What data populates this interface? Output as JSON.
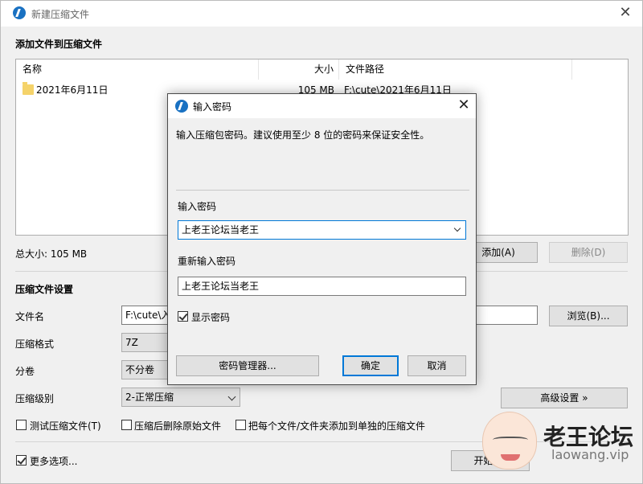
{
  "window": {
    "title": "新建压缩文件",
    "close_glyph": "✕"
  },
  "add_section": {
    "title": "添加文件到压缩文件"
  },
  "file_list": {
    "columns": [
      "名称",
      "大小",
      "文件路径"
    ],
    "rows": [
      {
        "name": "2021年6月11日",
        "size": "105 MB",
        "path": "F:\\cute\\2021年6月11日"
      }
    ]
  },
  "total_size": "总大小: 105 MB",
  "buttons": {
    "add": "添加(A)",
    "delete": "删除(D)",
    "browse": "浏览(B)...",
    "advanced": "高级设置 »",
    "start": "开始(S)"
  },
  "settings": {
    "title": "压缩文件设置",
    "filename_label": "文件名",
    "filename_value": "F:\\cute\\入",
    "format_label": "压缩格式",
    "format_value": "7Z",
    "split_label": "分卷",
    "split_value": "不分卷",
    "level_label": "压缩级别",
    "level_value": "2-正常压缩"
  },
  "options": {
    "test": "测试压缩文件(T)",
    "delete_after": "压缩后删除原始文件",
    "each_separate": "把每个文件/文件夹添加到单独的压缩文件",
    "more": "更多选项..."
  },
  "dialog": {
    "title": "输入密码",
    "close_glyph": "✕",
    "hint": "输入压缩包密码。建议使用至少 8 位的密码来保证安全性。",
    "password_label": "输入密码",
    "password_value": "上老王论坛当老王",
    "reenter_label": "重新输入密码",
    "reenter_value": "上老王论坛当老王",
    "show_password": "显示密码",
    "manager_button": "密码管理器...",
    "ok_button": "确定",
    "cancel_button": "取消"
  },
  "watermark": {
    "name": "老王论坛",
    "url": "laowang.vip"
  }
}
